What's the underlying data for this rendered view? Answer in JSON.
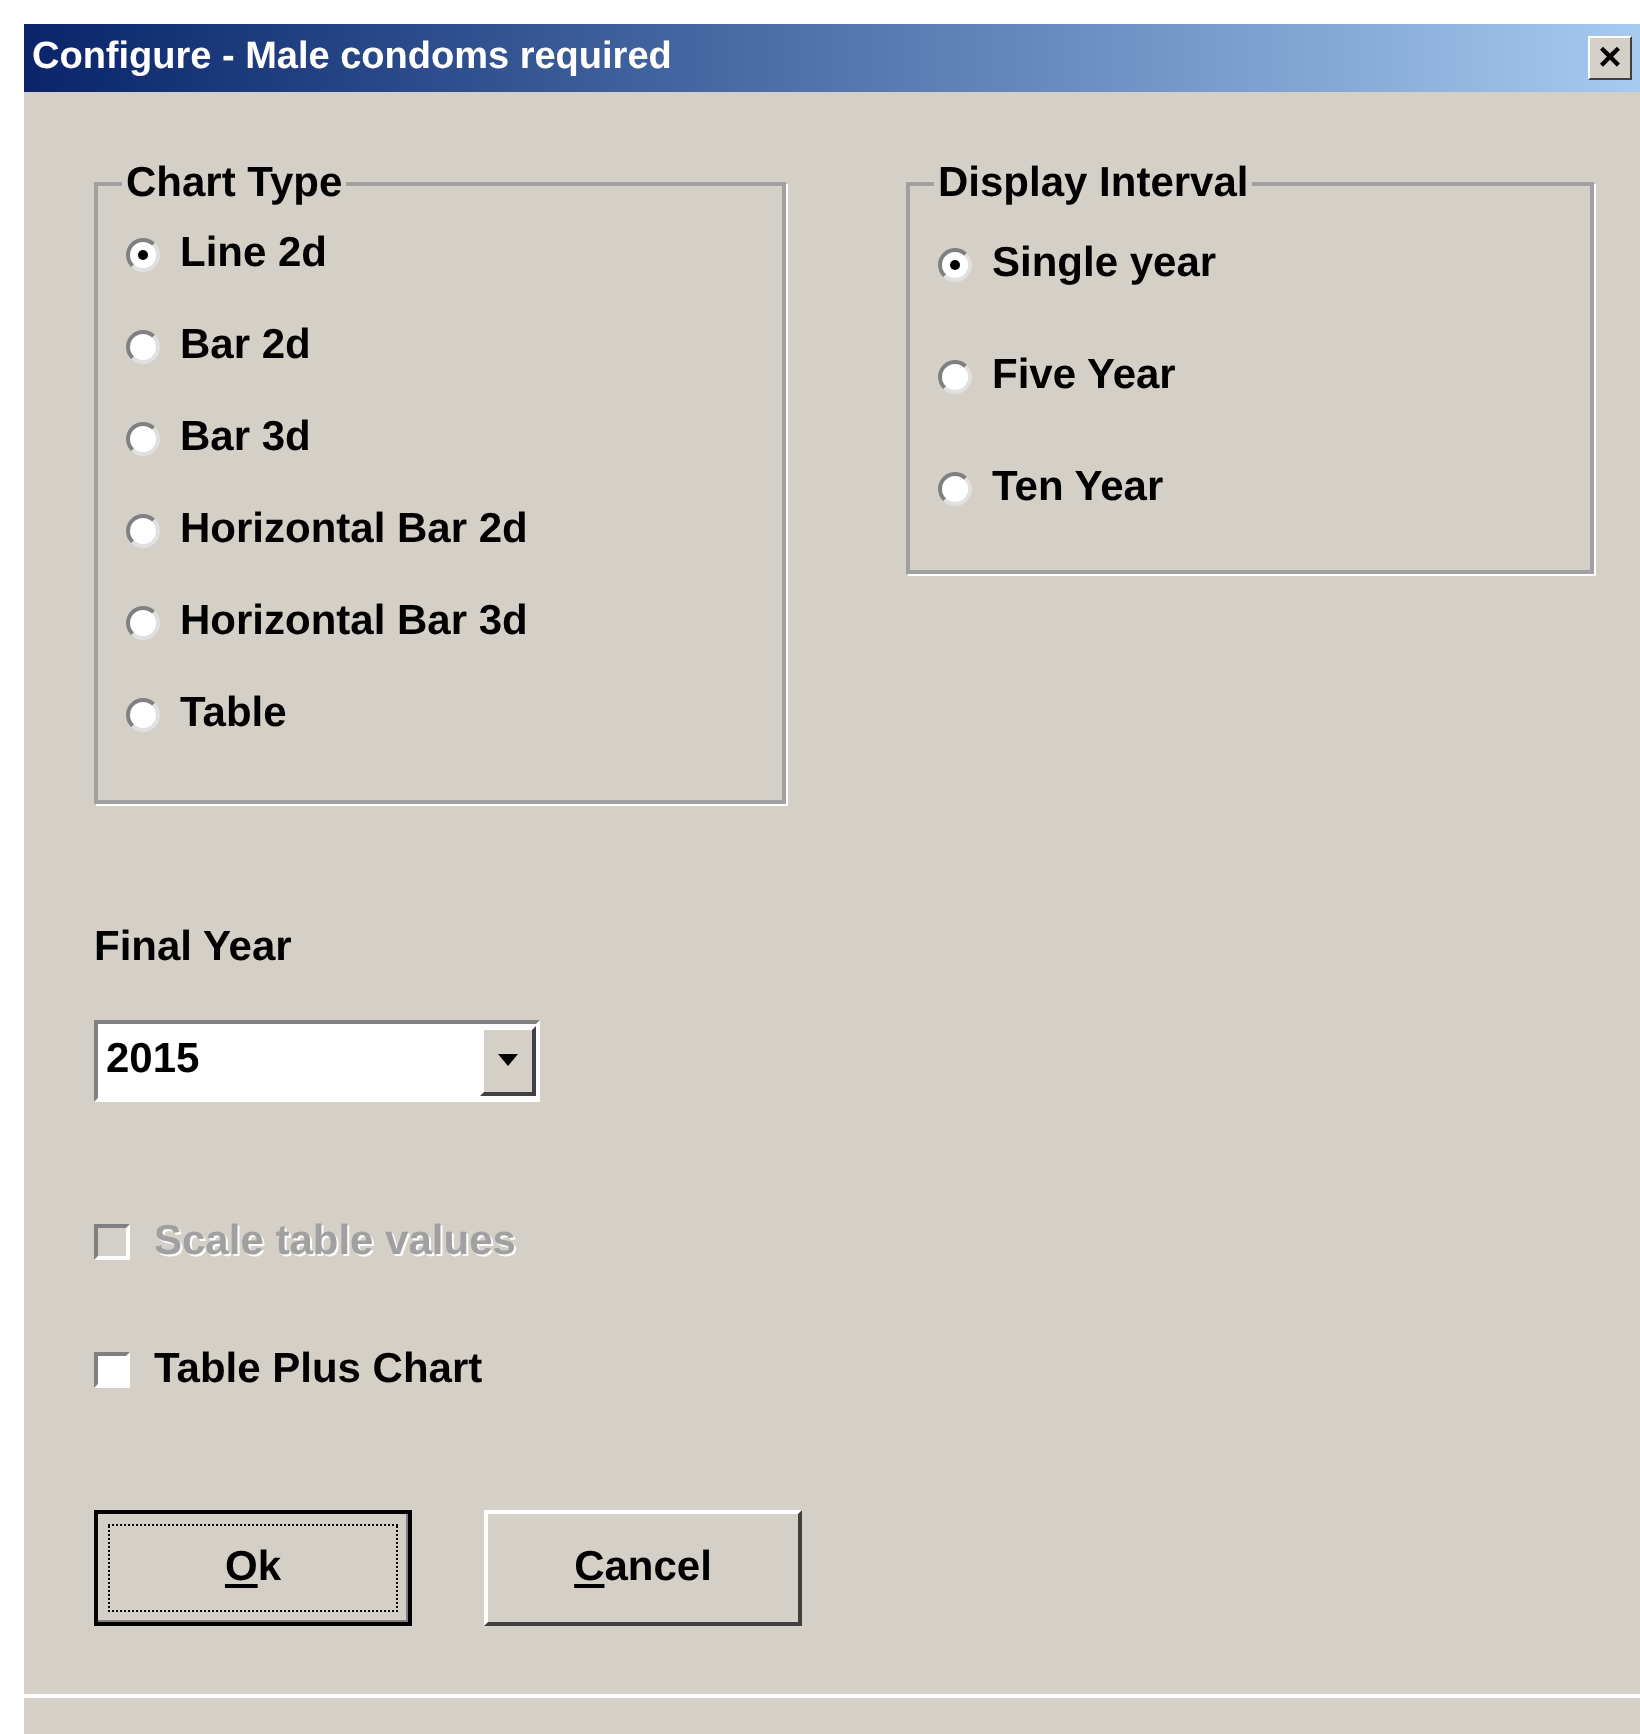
{
  "window": {
    "title": "Configure - Male condoms required",
    "close": "×"
  },
  "chart_type": {
    "title": "Chart Type",
    "options": [
      {
        "label": "Line 2d",
        "selected": true
      },
      {
        "label": "Bar 2d",
        "selected": false
      },
      {
        "label": "Bar 3d",
        "selected": false
      },
      {
        "label": "Horizontal Bar 2d",
        "selected": false
      },
      {
        "label": "Horizontal Bar 3d",
        "selected": false
      },
      {
        "label": "Table",
        "selected": false
      }
    ]
  },
  "display_interval": {
    "title": "Display Interval",
    "options": [
      {
        "label": "Single year",
        "selected": true
      },
      {
        "label": "Five Year",
        "selected": false
      },
      {
        "label": "Ten Year",
        "selected": false
      }
    ]
  },
  "final_year": {
    "label": "Final Year",
    "value": "2015"
  },
  "checkboxes": [
    {
      "label": "Scale table values",
      "checked": false,
      "disabled": true
    },
    {
      "label": "Table Plus Chart",
      "checked": false,
      "disabled": false
    }
  ],
  "buttons": [
    {
      "label": "Ok",
      "default": true
    },
    {
      "label": "Cancel",
      "default": false
    }
  ]
}
